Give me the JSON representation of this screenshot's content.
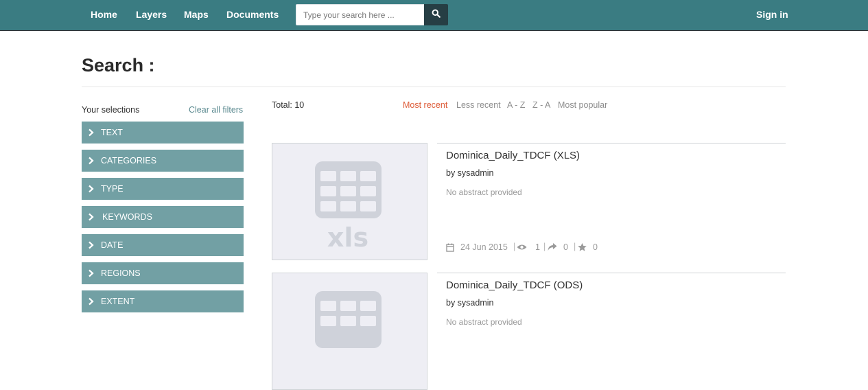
{
  "nav": {
    "home": "Home",
    "layers": "Layers",
    "maps": "Maps",
    "documents": "Documents",
    "search_placeholder": "Type your search here ...",
    "sign_in": "Sign in"
  },
  "page": {
    "title": "Search :"
  },
  "sidebar": {
    "selections_label": "Your selections",
    "clear_label": "Clear all filters",
    "filters": [
      "TEXT",
      "CATEGORIES",
      "TYPE",
      "KEYWORDS",
      "DATE",
      "REGIONS",
      "EXTENT"
    ]
  },
  "results": {
    "total_label": "Total: 10",
    "sort_options": [
      "Most recent",
      "Less recent",
      "A - Z",
      "Z - A",
      "Most popular"
    ],
    "active_sort": "Most recent",
    "items": [
      {
        "title": "Dominica_Daily_TDCF (XLS)",
        "author": "by sysadmin",
        "abstract": "No abstract provided",
        "thumb_label": "xls",
        "date": "24 Jun 2015",
        "views": "1",
        "shares": "0",
        "rating": "0",
        "icons": [
          "calendar-icon",
          "eye-icon",
          "share-icon",
          "star-icon"
        ]
      },
      {
        "title": "Dominica_Daily_TDCF (ODS)",
        "author": "by sysadmin",
        "abstract": "No abstract provided"
      }
    ]
  },
  "colors": {
    "navbar": "#3a7c82",
    "search_button": "#263e44",
    "filter_bg": "#72a0a4",
    "active_sort": "#dd5a36",
    "thumb_bg": "#eeeef4",
    "thumb_icon": "#cfd2da"
  }
}
